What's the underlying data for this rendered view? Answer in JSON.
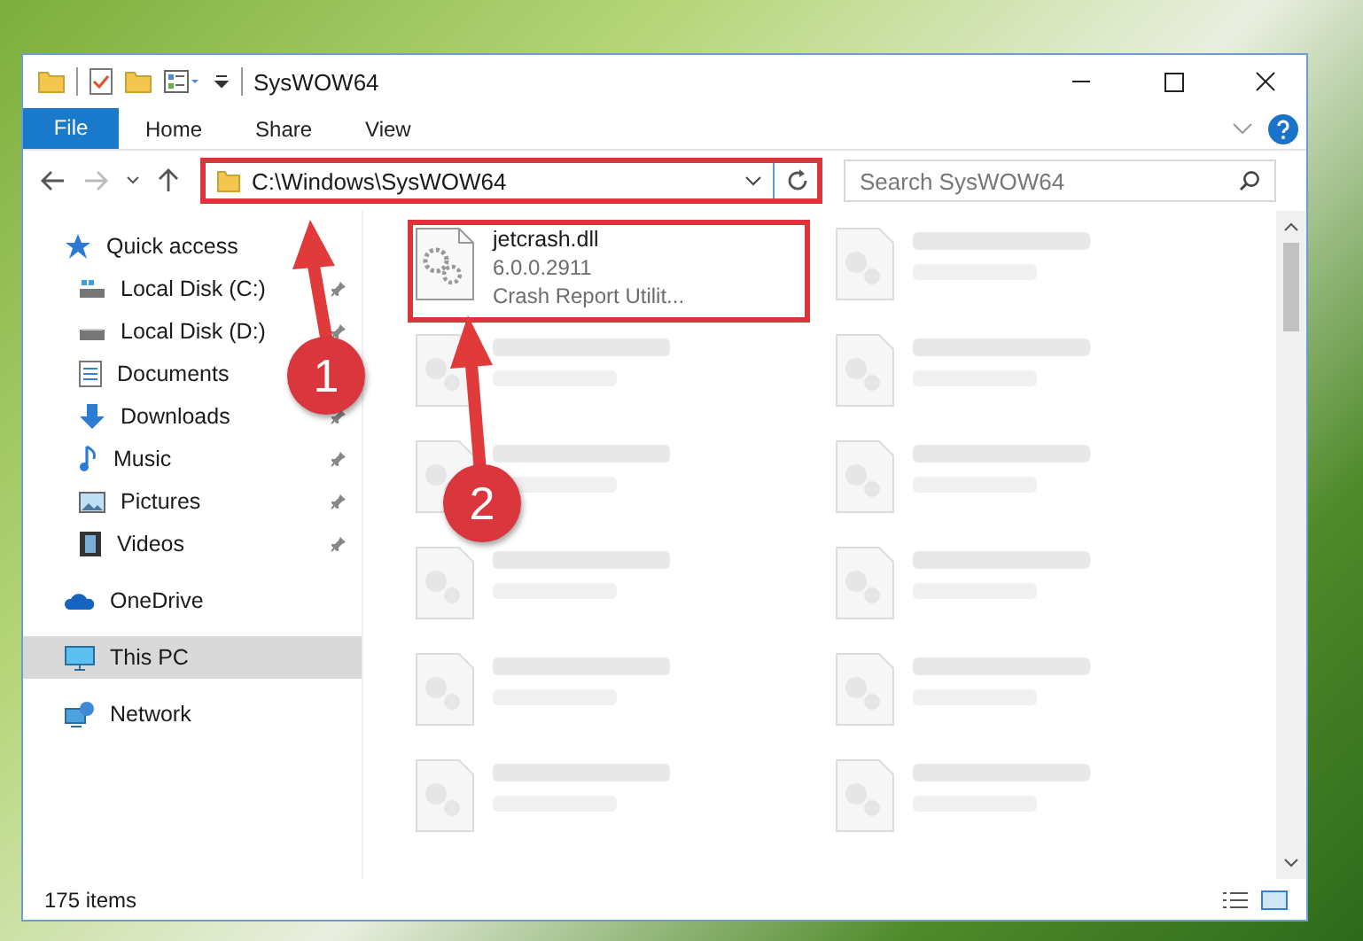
{
  "window": {
    "title": "SysWOW64"
  },
  "ribbon_tabs": [
    {
      "label": "File",
      "kind": "file",
      "selected": false
    },
    {
      "label": "Home",
      "kind": "tab",
      "selected": false
    },
    {
      "label": "Share",
      "kind": "tab",
      "selected": false
    },
    {
      "label": "View",
      "kind": "tab",
      "selected": false
    }
  ],
  "address_bar": {
    "path": "C:\\Windows\\SysWOW64",
    "highlighted": true
  },
  "search": {
    "placeholder": "Search SysWOW64"
  },
  "sidebar": {
    "items": [
      {
        "label": "Quick access",
        "selected": false,
        "children": [
          {
            "label": "Local Disk (C:)",
            "pinned": true
          },
          {
            "label": "Local Disk (D:)",
            "pinned": true
          },
          {
            "label": "Documents",
            "pinned": false
          },
          {
            "label": "Downloads",
            "pinned": true
          },
          {
            "label": "Music",
            "pinned": true
          },
          {
            "label": "Pictures",
            "pinned": true
          },
          {
            "label": "Videos",
            "pinned": true
          }
        ]
      },
      {
        "label": "OneDrive",
        "selected": false
      },
      {
        "label": "This PC",
        "selected": true
      },
      {
        "label": "Network",
        "selected": false
      }
    ]
  },
  "files": [
    {
      "kind": "file",
      "name": "jetcrash.dll",
      "lines": [
        "6.0.0.2911",
        "Crash Report Utilit..."
      ],
      "highlighted": true
    },
    {
      "kind": "blurred",
      "highlighted": false
    },
    {
      "kind": "blurred",
      "highlighted": false
    },
    {
      "kind": "blurred",
      "highlighted": false
    },
    {
      "kind": "blurred",
      "highlighted": false
    },
    {
      "kind": "blurred",
      "highlighted": false
    },
    {
      "kind": "blurred",
      "highlighted": false
    },
    {
      "kind": "blurred",
      "highlighted": false
    },
    {
      "kind": "blurred",
      "highlighted": false
    },
    {
      "kind": "blurred",
      "highlighted": false
    },
    {
      "kind": "blurred",
      "highlighted": false
    },
    {
      "kind": "blurred",
      "highlighted": false
    }
  ],
  "status_bar": {
    "count": "175 items"
  },
  "annotations": [
    {
      "label": "1"
    },
    {
      "label": "2"
    }
  ]
}
